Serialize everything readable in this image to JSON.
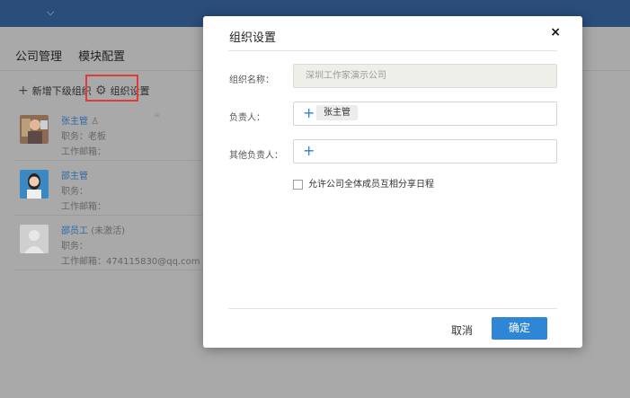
{
  "topbar": {
    "expand_icon": "chevron-down-icon",
    "expand_glyph": "⌵"
  },
  "nav": {
    "tabs": [
      {
        "label": "公司管理"
      },
      {
        "label": "模块配置"
      }
    ]
  },
  "toolbar": {
    "add_sub_org_label": "新增下级组织",
    "org_settings_label": "组织设置",
    "add_icon": "plus-icon",
    "settings_icon": "gear-icon",
    "lock_icon": "lock-icon"
  },
  "members": [
    {
      "name": "张主管",
      "role_label": "职务：",
      "role_value": "老板",
      "email_label": "工作邮箱：",
      "email_value": "",
      "status": "",
      "has_admin_icon": true
    },
    {
      "name": "邵主管",
      "role_label": "职务：",
      "role_value": "",
      "email_label": "工作邮箱：",
      "email_value": "",
      "status": "",
      "has_admin_icon": false
    },
    {
      "name": "邵员工",
      "role_label": "职务：",
      "role_value": "",
      "email_label": "工作邮箱：",
      "email_value": "474115830@qq.com",
      "status": "(未激活)",
      "has_admin_icon": false
    }
  ],
  "modal": {
    "title": "组织设置",
    "close_glyph": "×",
    "org_name_label": "组织名称：",
    "org_name_value": "深圳工作家演示公司",
    "manager_label": "负责人：",
    "manager_tags": [
      "张主管"
    ],
    "other_managers_label": "其他负责人：",
    "add_glyph": "+",
    "share_schedule_label": "允许公司全体成员互相分享日程",
    "share_schedule_checked": false,
    "cancel_label": "取消",
    "confirm_label": "确定",
    "accent_color": "#2f86d6"
  }
}
